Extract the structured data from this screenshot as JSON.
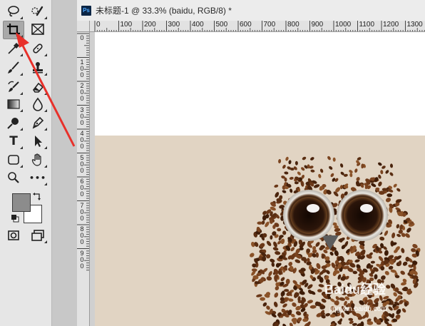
{
  "document": {
    "ps_badge": "Ps",
    "title": "未标题-1 @ 33.3% (baidu, RGB/8) *"
  },
  "rulers": {
    "horizontal": [
      "0",
      "100",
      "200",
      "300",
      "400",
      "500",
      "600",
      "700",
      "800",
      "900",
      "1000",
      "1100",
      "1200",
      "1300"
    ],
    "vertical": [
      "0",
      "1\n0\n0",
      "2\n0\n0",
      "3\n0\n0",
      "4\n0\n0",
      "5\n0\n0",
      "6\n0\n0",
      "7\n0\n0",
      "8\n0\n0",
      "9\n0\n0"
    ]
  },
  "toolbox": {
    "tools": [
      {
        "name": "lasso-tool",
        "icon": "lasso-icon"
      },
      {
        "name": "quick-selection-tool",
        "icon": "quick-selection-icon"
      },
      {
        "name": "crop-tool",
        "icon": "crop-icon",
        "active": true
      },
      {
        "name": "frame-tool",
        "icon": "frame-icon"
      },
      {
        "name": "eyedropper-tool",
        "icon": "eyedropper-icon"
      },
      {
        "name": "healing-brush-tool",
        "icon": "bandage-icon"
      },
      {
        "name": "brush-tool",
        "icon": "brush-icon"
      },
      {
        "name": "clone-stamp-tool",
        "icon": "stamp-icon"
      },
      {
        "name": "history-brush-tool",
        "icon": "history-brush-icon"
      },
      {
        "name": "eraser-tool",
        "icon": "eraser-icon"
      },
      {
        "name": "gradient-tool",
        "icon": "gradient-icon"
      },
      {
        "name": "blur-tool",
        "icon": "drop-icon"
      },
      {
        "name": "dodge-tool",
        "icon": "dodge-icon"
      },
      {
        "name": "pen-tool",
        "icon": "pen-icon"
      },
      {
        "name": "type-tool",
        "icon": "type-icon",
        "glyph": "T"
      },
      {
        "name": "path-selection-tool",
        "icon": "arrow-icon"
      },
      {
        "name": "rectangle-tool",
        "icon": "rounded-rectangle-icon"
      },
      {
        "name": "hand-tool",
        "icon": "hand-icon"
      },
      {
        "name": "zoom-tool",
        "icon": "magnifier-icon"
      },
      {
        "name": "more-tools",
        "icon": "ellipsis-icon",
        "glyph": "•••"
      },
      {
        "name": "quick-mask-mode",
        "icon": "quick-mask-icon"
      },
      {
        "name": "screen-mode",
        "icon": "screen-mode-icon"
      }
    ],
    "foreground_color": "#8c8c8c",
    "background_color": "#ffffff"
  },
  "canvas": {
    "top_color": "#ffffff",
    "photo_background": "#e1d4c3",
    "photo_subject": "coffee bean owl with two coffee cup eyes"
  },
  "watermark": {
    "text": "Baidu经验",
    "url": "jingyan.baidu.com"
  },
  "annotation": {
    "arrow_color": "#e8302a"
  }
}
